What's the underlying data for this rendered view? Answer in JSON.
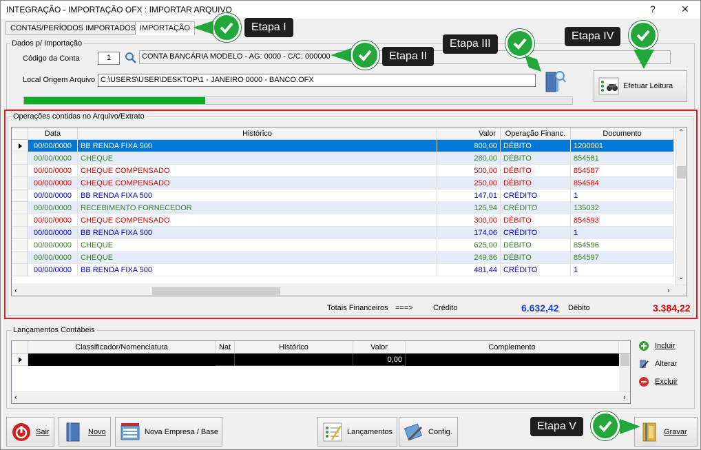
{
  "window": {
    "title": "INTEGRAÇÃO - IMPORTAÇÃO OFX : IMPORTAR ARQUIVO",
    "help": "?",
    "close": "✕"
  },
  "tabs": [
    {
      "label": "CONTAS/PERÍODOS IMPORTADOS"
    },
    {
      "label": "IMPORTAÇÃO"
    }
  ],
  "dados": {
    "group_label": "Dados p/ Importação",
    "codigo_label": "Código da Conta",
    "codigo_value": "1",
    "conta_desc": "CONTA BANCÁRIA MODELO - AG: 0000   - C/C: 000000",
    "origem_label": "Local Origem Arquivo",
    "origem_value": "C:\\USERS\\USER\\DESKTOP\\1 - JANEIRO 0000 - BANCO.OFX",
    "progress": 0.33,
    "leitura_label": "Efetuar Leitura"
  },
  "operacoes": {
    "group_label": "Operações contidas no Arquivo/Extrato",
    "columns": [
      "Data",
      "Histórico",
      "Valor",
      "Operação Financ.",
      "Documento"
    ],
    "rows": [
      {
        "data": "00/00/0000",
        "historico": "BB RENDA FIXA 500",
        "valor": "800,00",
        "operacao": "DÉBITO",
        "documento": "1200001",
        "color": "selected"
      },
      {
        "data": "00/00/0000",
        "historico": "CHEQUE",
        "valor": "280,00",
        "operacao": "DÉBITO",
        "documento": "854581",
        "color": "#3a7a2a"
      },
      {
        "data": "00/00/0000",
        "historico": "CHEQUE COMPENSADO",
        "valor": "500,00",
        "operacao": "DÉBITO",
        "documento": "854587",
        "color": "#e00000"
      },
      {
        "data": "00/00/0000",
        "historico": "CHEQUE COMPENSADO",
        "valor": "250,00",
        "operacao": "DÉBITO",
        "documento": "854584",
        "color": "#e00000"
      },
      {
        "data": "00/00/0000",
        "historico": "BB RENDA FIXA 500",
        "valor": "147,01",
        "operacao": "CRÉDITO",
        "documento": "1",
        "color": "#0000cc"
      },
      {
        "data": "00/00/0000",
        "historico": "RECEBIMENTO FORNECEDOR",
        "valor": "125,94",
        "operacao": "CRÉDITO",
        "documento": "135032",
        "color": "#3a7a2a"
      },
      {
        "data": "00/00/0000",
        "historico": "CHEQUE COMPENSADO",
        "valor": "300,00",
        "operacao": "DÉBITO",
        "documento": "854593",
        "color": "#e00000"
      },
      {
        "data": "00/00/0000",
        "historico": "BB RENDA FIXA 500",
        "valor": "174,06",
        "operacao": "CRÉDITO",
        "documento": "1",
        "color": "#0000cc"
      },
      {
        "data": "00/00/0000",
        "historico": "CHEQUE",
        "valor": "625,00",
        "operacao": "DÉBITO",
        "documento": "854596",
        "color": "#3a7a2a"
      },
      {
        "data": "00/00/0000",
        "historico": "CHEQUE",
        "valor": "249,86",
        "operacao": "DÉBITO",
        "documento": "854597",
        "color": "#3a7a2a"
      },
      {
        "data": "00/00/0000",
        "historico": "BB RENDA FIXA 500",
        "valor": "481,44",
        "operacao": "CRÉDITO",
        "documento": "1",
        "color": "#0000cc"
      }
    ],
    "totais_label": "Totais Financeiros",
    "arrow": "===>",
    "credito_label": "Crédito",
    "credito_value": "6.632,42",
    "debito_label": "Débito",
    "debito_value": "3.384,22"
  },
  "lancamentos": {
    "group_label": "Lançamentos Contábeis",
    "columns": [
      "Classificador/Nomenclatura",
      "Nat",
      "Histórico",
      "Valor",
      "Complemento"
    ],
    "row_valor": "0,00",
    "incluir": "Incluir",
    "alterar": "Alterar",
    "excluir": "Excluir"
  },
  "bottom": {
    "sair": "Sair",
    "novo": "Novo",
    "nova_empresa": "Nova Empresa / Base",
    "lancamentos": "Lançamentos",
    "config": "Config.",
    "gravar": "Gravar"
  },
  "callouts": {
    "etapa1": "Etapa I",
    "etapa2": "Etapa II",
    "etapa3": "Etapa III",
    "etapa4": "Etapa IV",
    "etapa5": "Etapa V"
  },
  "colors": {
    "accent_red": "#e00000",
    "credit_blue": "#0000cc",
    "selected": "#0078d7",
    "check_green": "#22a83a"
  }
}
